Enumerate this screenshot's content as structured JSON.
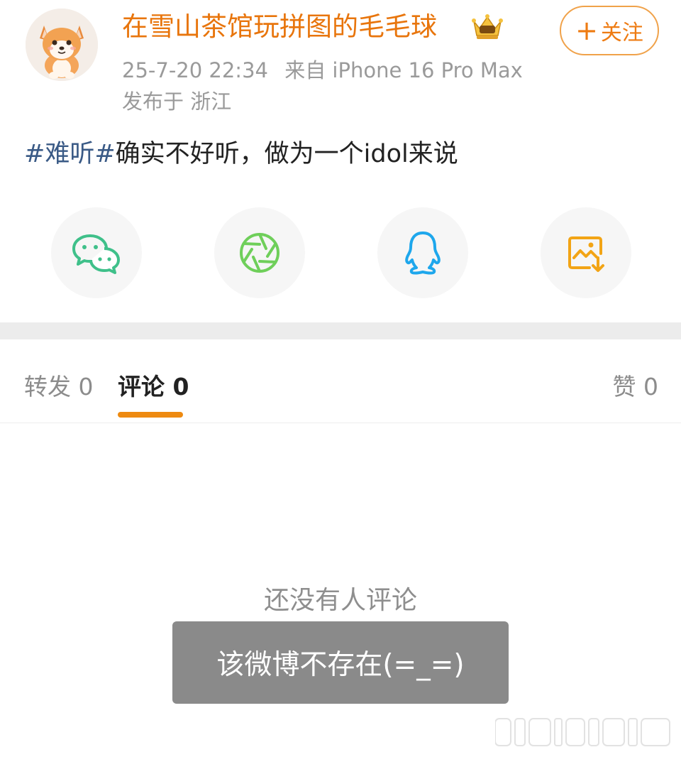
{
  "post": {
    "author": "在雪山茶馆玩拼图的毛毛球",
    "timestamp": "25-7-20 22:34",
    "source": "来自 iPhone 16 Pro Max",
    "location": "发布于 浙江",
    "topic": "#难听#",
    "text": "确实不好听，做为一个idol来说",
    "follow_label": "关注",
    "follow_icon": "plus-icon"
  },
  "share": [
    {
      "name": "wechat",
      "icon": "wechat-icon",
      "color": "#3fc08a"
    },
    {
      "name": "moments",
      "icon": "moments-icon",
      "color": "#6fcf5a"
    },
    {
      "name": "qq",
      "icon": "qq-icon",
      "color": "#1ea7ec"
    },
    {
      "name": "save-image",
      "icon": "save-image-icon",
      "color": "#f2a415"
    }
  ],
  "tabs": {
    "repost": "转发 0",
    "comment": "评论 0",
    "like": "赞 0",
    "active": "comment",
    "accent": "#ee8a10"
  },
  "empty_state": "还没有人评论",
  "toast": "该微博不存在(=_=)"
}
